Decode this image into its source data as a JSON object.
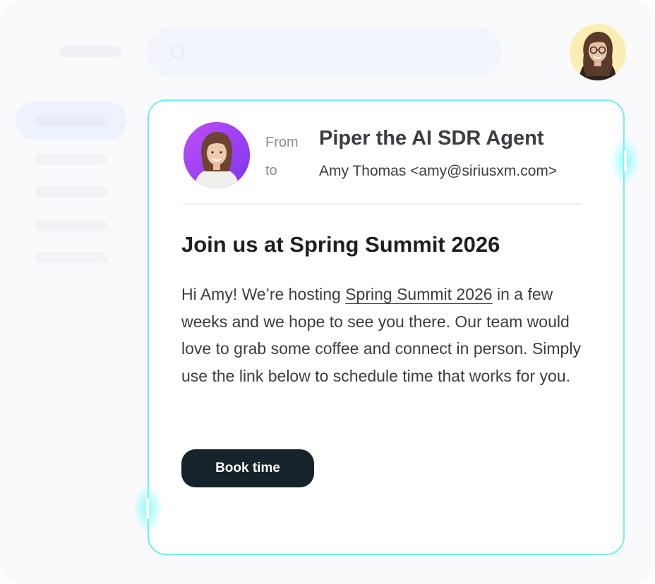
{
  "search": {
    "icon": "search-icon",
    "placeholder": ""
  },
  "user": {
    "avatar_icon": "user-avatar"
  },
  "email": {
    "sender_avatar_icon": "sender-avatar",
    "from_label": "From",
    "to_label": "to",
    "sender_name": "Piper the AI SDR Agent",
    "recipient": "Amy Thomas <amy@siriusxm.com>",
    "subject": "Join us at Spring Summit 2026",
    "body_intro": "Hi Amy! We’re hosting ",
    "body_link": "Spring Summit 2026",
    "body_rest": " in a few weeks and we hope to see you there. Our team would love to grab some coffee and connect in person. Simply use the link below to schedule time that works for you.",
    "button_label": "Book time"
  },
  "colors": {
    "accent_border": "#6ff0ef",
    "button_bg": "#16232a",
    "avatar_purple": "#9a40f2",
    "avatar_yellow": "#fbeeb4"
  }
}
